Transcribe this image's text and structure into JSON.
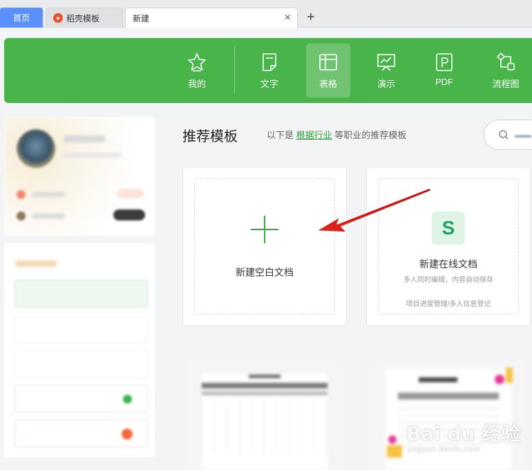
{
  "tabs": {
    "home": "首页",
    "daoke": "稻壳模板",
    "new": "新建",
    "close_glyph": "×",
    "add_glyph": "+"
  },
  "header": {
    "items": [
      {
        "label": "我的",
        "icon": "star-icon"
      },
      {
        "label": "文字",
        "icon": "document-icon"
      },
      {
        "label": "表格",
        "icon": "spreadsheet-icon",
        "active": true
      },
      {
        "label": "演示",
        "icon": "presentation-icon"
      },
      {
        "label": "PDF",
        "icon": "pdf-icon"
      },
      {
        "label": "流程图",
        "icon": "flowchart-icon"
      }
    ]
  },
  "main": {
    "title": "推荐模板",
    "subtitle_prefix": "以下是",
    "subtitle_link": "根据行业",
    "subtitle_suffix": "等职业的推荐模板"
  },
  "cards": {
    "blank_label": "新建空白文档",
    "online_icon_letter": "S",
    "online_title": "新建在线文档",
    "online_sub": "多人同时编辑，内容自动保存",
    "online_foot": "项目进度管理/多人信息登记"
  },
  "watermark": {
    "main": "Bai du 经验",
    "sub": "jingyan.baidu.com"
  },
  "colors": {
    "brand_green": "#48b44a",
    "home_tab_blue": "#5b8ff9",
    "annotation_red": "#e0241d"
  }
}
